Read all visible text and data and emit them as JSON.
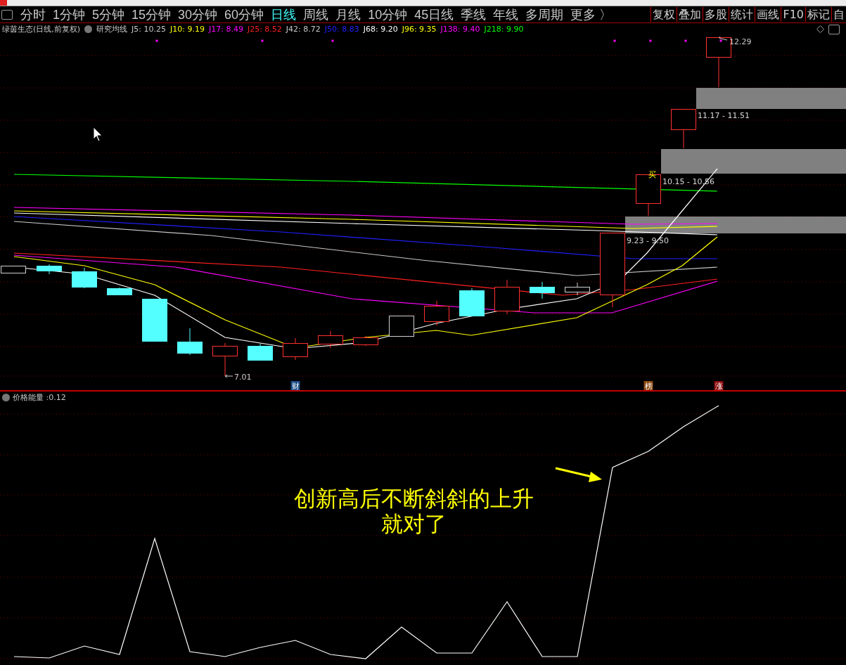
{
  "period_tabs": [
    {
      "label": "分时",
      "selected": false
    },
    {
      "label": "1分钟",
      "selected": false
    },
    {
      "label": "5分钟",
      "selected": false
    },
    {
      "label": "15分钟",
      "selected": false
    },
    {
      "label": "30分钟",
      "selected": false
    },
    {
      "label": "60分钟",
      "selected": false
    },
    {
      "label": "日线",
      "selected": true
    },
    {
      "label": "周线",
      "selected": false
    },
    {
      "label": "月线",
      "selected": false
    },
    {
      "label": "10分钟",
      "selected": false
    },
    {
      "label": "45日线",
      "selected": false
    },
    {
      "label": "季线",
      "selected": false
    },
    {
      "label": "年线",
      "selected": false
    },
    {
      "label": "多周期",
      "selected": false
    },
    {
      "label": "更多 〉",
      "selected": false
    }
  ],
  "tools": [
    "复权",
    "叠加",
    "多股",
    "统计",
    "画线",
    "F10",
    "标记",
    "自"
  ],
  "info": {
    "title": "绿茵生态(日线,前复权)",
    "indicator": "研究均线",
    "averages": [
      {
        "label": "J5: 10.25",
        "color": "#c8c8c8"
      },
      {
        "label": "J10: 9.19",
        "color": "#ffff00"
      },
      {
        "label": "J17: 8.49",
        "color": "#ff00ff"
      },
      {
        "label": "J25: 8.52",
        "color": "#ff2020"
      },
      {
        "label": "J42: 8.72",
        "color": "#c8c8c8"
      },
      {
        "label": "J50: 8.83",
        "color": "#2020ff"
      },
      {
        "label": "J68: 9.20",
        "color": "#ffffff"
      },
      {
        "label": "J96: 9.35",
        "color": "#ffff00"
      },
      {
        "label": "J138: 9.40",
        "color": "#ff00ff"
      },
      {
        "label": "J218: 9.90",
        "color": "#00ff00"
      }
    ]
  },
  "chart": {
    "high_label": "12.29",
    "low_label": "7.01",
    "zones": [
      "11.17 - 11.51",
      "10.15 - 10.56",
      "9.23 - 9.50"
    ],
    "buy_mark": "买",
    "events": [
      {
        "text": "财",
        "color": "#1c4a86"
      },
      {
        "text": "榜",
        "color": "#8a4a10"
      },
      {
        "text": "涨",
        "color": "#8a0a0a"
      }
    ]
  },
  "indicator": {
    "title": "价格能量",
    "value": ":0.12"
  },
  "annotation": {
    "lines": [
      "创新高后不断斜斜的上升",
      "就对了"
    ]
  }
}
